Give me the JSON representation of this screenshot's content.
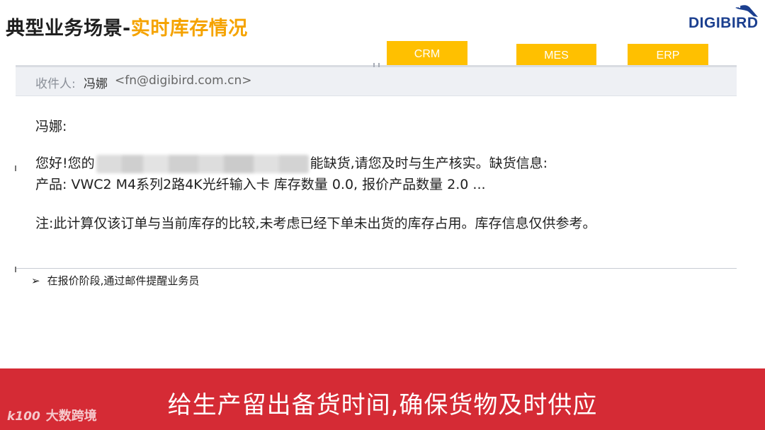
{
  "header": {
    "title_main": "典型业务场景",
    "title_dash": "-",
    "title_accent": "实时库存情况",
    "logo_text": "DIGIBIRD"
  },
  "tags": {
    "crm": "CRM",
    "mes": "MES",
    "erp": "ERP"
  },
  "email": {
    "recipient_label": "收件人:",
    "recipient_name": "冯娜",
    "recipient_email": "<fn@digibird.com.cn>",
    "greeting": "冯娜:",
    "line1_prefix": "您好!您的",
    "line1_suffix": "能缺货,请您及时与生产核实。缺货信息:",
    "line2": "产品: VWC2 M4系列2路4K光纤输入卡 库存数量 0.0, 报价产品数量 2.0 ...",
    "note": "注:此计算仅该订单与当前库存的比较,未考虑已经下单未出货的库存占用。库存信息仅供参考。"
  },
  "bullet": {
    "arrow": "➢",
    "text": "在报价阶段,通过邮件提醒业务员"
  },
  "banner": {
    "text": "给生产留出备货时间,确保货物及时供应"
  },
  "watermark": {
    "logo": "k100",
    "text": "大数跨境"
  },
  "colors": {
    "accent_orange": "#f5a300",
    "tag_yellow": "#ffc000",
    "banner_red": "#d52b35",
    "logo_blue": "#1b3f8f"
  }
}
